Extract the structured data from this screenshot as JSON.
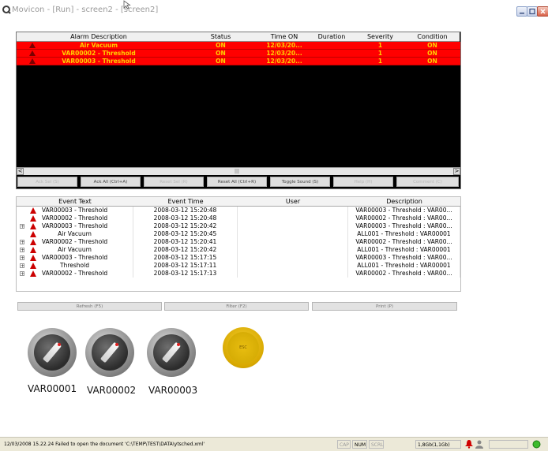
{
  "window": {
    "title": "Movicon - [Run] - screen2 - [screen2]"
  },
  "colors": {
    "alarm_row_bg": "#ff0000",
    "alarm_text": "#ffd000",
    "alarm_window_bg": "#000000",
    "esc_button": "#e8bd10",
    "knob_indicator": "#e02020"
  },
  "alarm_window": {
    "columns": [
      "Alarm Description",
      "Status",
      "Time ON",
      "Duration",
      "Severity",
      "Condition"
    ],
    "rows": [
      {
        "description": "Air Vacuum",
        "status": "ON",
        "time_on": "12/03/20...",
        "duration": "",
        "severity": "1",
        "condition": "ON"
      },
      {
        "description": "VAR00002 - Threshold",
        "status": "ON",
        "time_on": "12/03/20...",
        "duration": "",
        "severity": "1",
        "condition": "ON"
      },
      {
        "description": "VAR00003 - Threshold",
        "status": "ON",
        "time_on": "12/03/20...",
        "duration": "",
        "severity": "1",
        "condition": "ON"
      }
    ],
    "scroll_left": "<",
    "scroll_mid": "|||",
    "scroll_right": ">",
    "buttons": [
      {
        "label": "Ack Sel (S)",
        "enabled": false
      },
      {
        "label": "Ack All (Ctrl+A)",
        "enabled": true
      },
      {
        "label": "Reset Sel (R)",
        "enabled": false
      },
      {
        "label": "Reset All (Ctrl+R)",
        "enabled": true
      },
      {
        "label": "Toggle Sound (S)",
        "enabled": true
      },
      {
        "label": "Help (H)",
        "enabled": false
      },
      {
        "label": "Comment (C)",
        "enabled": false
      }
    ]
  },
  "event_window": {
    "columns": [
      "Event Text",
      "Event Time",
      "User",
      "Description"
    ],
    "rows": [
      {
        "expand": "",
        "text": "VAR00003 - Threshold",
        "time": "2008-03-12 15:20:48",
        "user": "",
        "description": "VAR00003 - Threshold : VAR00..."
      },
      {
        "expand": "",
        "text": "VAR00002 - Threshold",
        "time": "2008-03-12 15:20:48",
        "user": "",
        "description": "VAR00002 - Threshold : VAR00..."
      },
      {
        "expand": "+",
        "text": "VAR00003 - Threshold",
        "time": "2008-03-12 15:20:42",
        "user": "",
        "description": "VAR00003 - Threshold : VAR00..."
      },
      {
        "expand": "",
        "text": "Air Vacuum",
        "time": "2008-03-12 15:20:45",
        "user": "",
        "description": "ALL001 - Threshold : VAR00001"
      },
      {
        "expand": "+",
        "text": "VAR00002 - Threshold",
        "time": "2008-03-12 15:20:41",
        "user": "",
        "description": "VAR00002 - Threshold : VAR00..."
      },
      {
        "expand": "+",
        "text": "Air Vacuum",
        "time": "2008-03-12 15:20:42",
        "user": "",
        "description": "ALL001 - Threshold : VAR00001"
      },
      {
        "expand": "+",
        "text": "VAR00003 - Threshold",
        "time": "2008-03-12 15:17:15",
        "user": "",
        "description": "VAR00003 - Threshold : VAR00..."
      },
      {
        "expand": "+",
        "text": "Threshold",
        "time": "2008-03-12 15:17:11",
        "user": "",
        "description": "ALL001 - Threshold : VAR00001"
      },
      {
        "expand": "+",
        "text": "VAR00002 - Threshold",
        "time": "2008-03-12 15:17:13",
        "user": "",
        "description": "VAR00002 - Threshold : VAR00..."
      }
    ],
    "buttons": [
      "Refresh (F5)",
      "Filter (F2)",
      "Print (P)"
    ]
  },
  "knobs": [
    {
      "label": "VAR00001",
      "icon": "knob-icon"
    },
    {
      "label": "VAR00002",
      "icon": "knob-icon"
    },
    {
      "label": "VAR00003",
      "icon": "knob-icon"
    }
  ],
  "esc_button": {
    "label": "ESC"
  },
  "status_bar": {
    "message": "12/03/2008 15.22.24 Failed to open the document 'C:\\TEMP\\TEST\\DATA\\ytsched.xml'",
    "cap": "CAP",
    "num": "NUM",
    "scrl": "SCRL",
    "disk": "1,8Gb(1,1Gb)"
  }
}
